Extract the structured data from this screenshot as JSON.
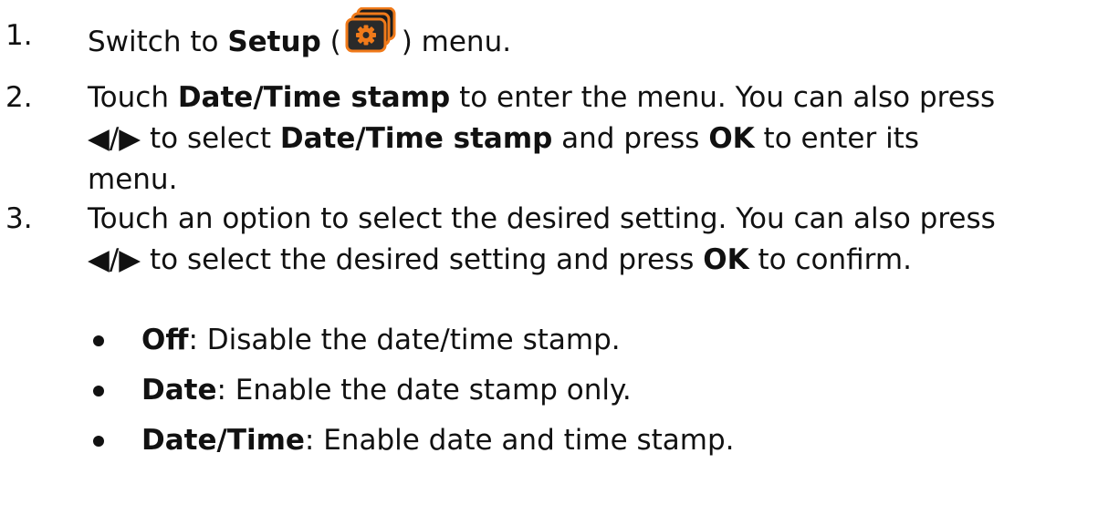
{
  "steps": [
    {
      "number": "1.",
      "prefix": "Switch to ",
      "bold1": "Setup",
      "paren_open": " (",
      "paren_close": ") menu.",
      "icon": "setup-gear-icon"
    },
    {
      "number": "2.",
      "line1_a": "Touch ",
      "line1_bold": "Date/Time stamp",
      "line1_b": " to enter the menu. You can also press",
      "line2_arrows": "◀/▶",
      "line2_a": " to select ",
      "line2_bold1": "Date/Time stamp",
      "line2_b": " and press ",
      "line2_bold2": "OK",
      "line2_c": " to enter its",
      "line3": "menu."
    },
    {
      "number": "3.",
      "line1": "Touch an option to select the desired setting. You can also press",
      "line2_arrows": "◀/▶",
      "line2_a": " to select the desired setting and press ",
      "line2_bold": "OK",
      "line2_b": " to confirm."
    }
  ],
  "options": [
    {
      "name": "Off",
      "desc": ": Disable the date/time stamp."
    },
    {
      "name": "Date",
      "desc": ": Enable the date stamp only."
    },
    {
      "name": "Date/Time",
      "desc": ": Enable date and time stamp."
    }
  ],
  "colors": {
    "icon_orange": "#f07a1a",
    "icon_dark": "#2a2a2a",
    "text": "#111111"
  }
}
